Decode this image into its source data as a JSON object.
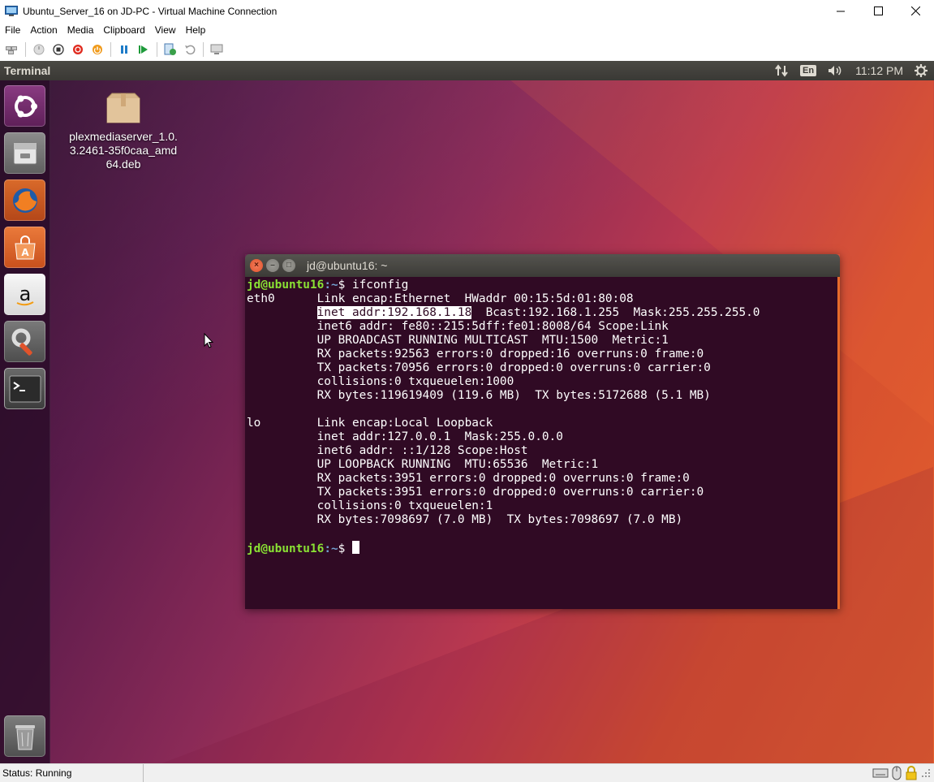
{
  "window": {
    "title": "Ubuntu_Server_16 on JD-PC - Virtual Machine Connection"
  },
  "menubar": {
    "items": [
      "File",
      "Action",
      "Media",
      "Clipboard",
      "View",
      "Help"
    ]
  },
  "toolbar": {
    "icons": [
      "ctrl-alt-del-icon",
      "start-icon",
      "turn-off-icon",
      "shut-down-icon",
      "save-icon",
      "pause-icon",
      "reset-icon",
      "checkpoint-icon",
      "revert-icon",
      "enhanced-session-icon"
    ]
  },
  "guest": {
    "topbar": {
      "app_name": "Terminal",
      "language": "En",
      "clock": "11:12 PM"
    },
    "desktop_icon": {
      "label": "plexmediaserver_1.0.3.2461-35f0caa_amd64.deb"
    },
    "launcher": [
      "dash-icon",
      "files-icon",
      "firefox-icon",
      "software-center-icon",
      "amazon-icon",
      "system-settings-icon",
      "terminal-icon",
      "trash-icon"
    ],
    "terminal": {
      "title": "jd@ubuntu16: ~",
      "prompt_user": "jd@ubuntu16",
      "prompt_path": ":~",
      "prompt_symbol": "$",
      "command": " ifconfig",
      "eth0": {
        "iface": "eth0",
        "line1": "Link encap:Ethernet  HWaddr 00:15:5d:01:80:08",
        "inet_highlight": "inet addr:192.168.1.18",
        "inet_rest": "  Bcast:192.168.1.255  Mask:255.255.255.0",
        "line3": "inet6 addr: fe80::215:5dff:fe01:8008/64 Scope:Link",
        "line4": "UP BROADCAST RUNNING MULTICAST  MTU:1500  Metric:1",
        "line5": "RX packets:92563 errors:0 dropped:16 overruns:0 frame:0",
        "line6": "TX packets:70956 errors:0 dropped:0 overruns:0 carrier:0",
        "line7": "collisions:0 txqueuelen:1000",
        "line8": "RX bytes:119619409 (119.6 MB)  TX bytes:5172688 (5.1 MB)"
      },
      "lo": {
        "iface": "lo",
        "line1": "Link encap:Local Loopback",
        "line2": "inet addr:127.0.0.1  Mask:255.0.0.0",
        "line3": "inet6 addr: ::1/128 Scope:Host",
        "line4": "UP LOOPBACK RUNNING  MTU:65536  Metric:1",
        "line5": "RX packets:3951 errors:0 dropped:0 overruns:0 frame:0",
        "line6": "TX packets:3951 errors:0 dropped:0 overruns:0 carrier:0",
        "line7": "collisions:0 txqueuelen:1",
        "line8": "RX bytes:7098697 (7.0 MB)  TX bytes:7098697 (7.0 MB)"
      }
    }
  },
  "statusbar": {
    "text": "Status: Running"
  },
  "colors": {
    "terminal_bg": "#300a24",
    "prompt_user": "#8ae234",
    "prompt_path": "#729fcf",
    "accent": "#e66b2b"
  }
}
